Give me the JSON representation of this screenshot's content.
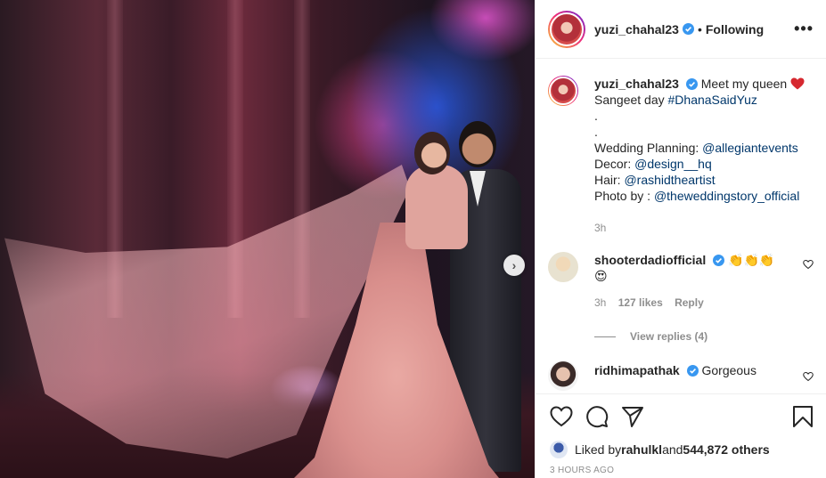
{
  "post": {
    "author": "yuzi_chahal23",
    "follow_status": "Following",
    "more_label": "•••",
    "next_label": "›"
  },
  "caption": {
    "username": "yuzi_chahal23",
    "line1_text": "Meet my queen",
    "line2_prefix": "Sangeet day ",
    "hashtag": "#DhanaSaidYuz",
    "dots": [
      ".",
      "."
    ],
    "credits": [
      {
        "label": "Wedding Planning: ",
        "handle": "@allegiantevents"
      },
      {
        "label": "Decor: ",
        "handle": "@design__hq"
      },
      {
        "label": "Hair: ",
        "handle": "@rashidtheartist"
      },
      {
        "label": "Photo by : ",
        "handle": "@theweddingstory_official"
      }
    ],
    "time": "3h"
  },
  "comments": [
    {
      "username": "shooterdadiofficial",
      "text_line1": "👏👏👏",
      "text_line2": "😍",
      "time": "3h",
      "likes": "127 likes",
      "reply": "Reply",
      "view_replies": "View replies (4)"
    },
    {
      "username": "ridhimapathak",
      "text": "Gorgeous"
    }
  ],
  "footer": {
    "liked_by_prefix": "Liked by ",
    "liked_by_user": "rahulkl",
    "liked_by_and": " and ",
    "liked_by_others": "544,872 others",
    "timestamp": "3 HOURS AGO"
  },
  "colors": {
    "verified": "#3897f0",
    "heart": "#ed4956",
    "link": "#00376b",
    "muted": "#8e8e8e"
  }
}
